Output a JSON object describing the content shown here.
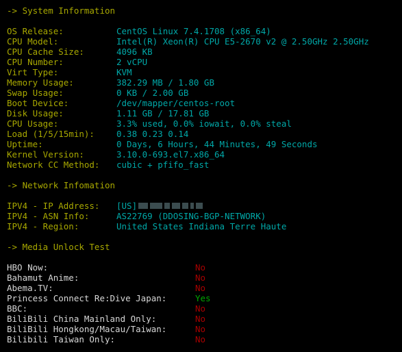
{
  "terminal": {
    "background": "#000000",
    "colors": {
      "header": "#a8a800",
      "label_yellow": "#a8a800",
      "label_white": "#d8d8d8",
      "value_cyan": "#00a8a8",
      "value_red": "#a80000",
      "value_green": "#00a800",
      "redaction_block": "#5f7b80"
    }
  },
  "sections": {
    "system": {
      "header": "-> System Information",
      "rows": [
        {
          "label": "OS Release:",
          "value": "CentOS Linux 7.4.1708 (x86_64)"
        },
        {
          "label": "CPU Model:",
          "value": "Intel(R) Xeon(R) CPU E5-2670 v2 @ 2.50GHz 2.50GHz"
        },
        {
          "label": "CPU Cache Size:",
          "value": "4096 KB"
        },
        {
          "label": "CPU Number:",
          "value": "2 vCPU"
        },
        {
          "label": "Virt Type:",
          "value": "KVM"
        },
        {
          "label": "Memory Usage:",
          "value": "382.29 MB / 1.80 GB"
        },
        {
          "label": "Swap Usage:",
          "value": "0 KB / 2.00 GB"
        },
        {
          "label": "Boot Device:",
          "value": "/dev/mapper/centos-root"
        },
        {
          "label": "Disk Usage:",
          "value": "1.11 GB / 17.81 GB"
        },
        {
          "label": "CPU Usage:",
          "value": "3.3% used, 0.0% iowait, 0.0% steal"
        },
        {
          "label": "Load (1/5/15min):",
          "value": "0.38 0.23 0.14"
        },
        {
          "label": "Uptime:",
          "value": "0 Days, 6 Hours, 44 Minutes, 49 Seconds"
        },
        {
          "label": "Kernel Version:",
          "value": "3.10.0-693.el7.x86_64"
        },
        {
          "label": "Network CC Method:",
          "value": "cubic + pfifo_fast"
        }
      ]
    },
    "network": {
      "header": "-> Network Infomation",
      "ip_row": {
        "label": "IPV4 - IP Address:",
        "country": "[US]",
        "redacted": true,
        "redaction_block_widths": [
          14,
          18,
          8,
          12,
          9,
          5,
          10
        ]
      },
      "rows": [
        {
          "label": "IPV4 - ASN Info:",
          "value": "AS22769 (DDOSING-BGP-NETWORK)"
        },
        {
          "label": "IPV4 - Region:",
          "value": "United States Indiana Terre Haute"
        }
      ]
    },
    "media": {
      "header": "-> Media Unlock Test",
      "rows": [
        {
          "label": "HBO Now:",
          "value": "No",
          "state": "no"
        },
        {
          "label": "Bahamut Anime:",
          "value": "No",
          "state": "no"
        },
        {
          "label": "Abema.TV:",
          "value": "No",
          "state": "no"
        },
        {
          "label": "Princess Connect Re:Dive Japan:",
          "value": "Yes",
          "state": "yes"
        },
        {
          "label": "BBC:",
          "value": "No",
          "state": "no"
        },
        {
          "label": "BiliBili China Mainland Only:",
          "value": "No",
          "state": "no"
        },
        {
          "label": "BiliBili Hongkong/Macau/Taiwan:",
          "value": "No",
          "state": "no"
        },
        {
          "label": "Bilibili Taiwan Only:",
          "value": "No",
          "state": "no"
        }
      ]
    }
  }
}
